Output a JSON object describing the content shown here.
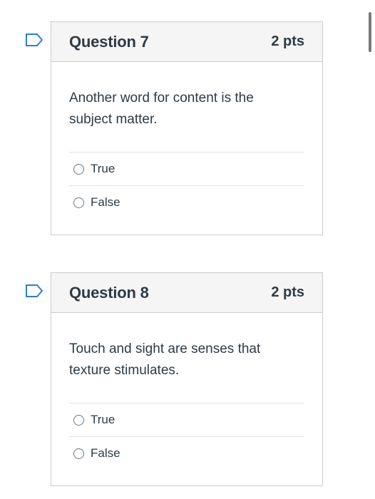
{
  "questions": [
    {
      "title": "Question 7",
      "points": "2 pts",
      "text": "Another word for content is the subject matter.",
      "answers": [
        {
          "label": "True"
        },
        {
          "label": "False"
        }
      ]
    },
    {
      "title": "Question 8",
      "points": "2 pts",
      "text": "Touch and sight are senses that texture stimulates.",
      "answers": [
        {
          "label": "True"
        },
        {
          "label": "False"
        }
      ]
    }
  ],
  "icons": {
    "flag": "flag-outline-icon",
    "radio": "radio-unselected"
  },
  "colors": {
    "text": "#2d3b45",
    "header_bg": "#f5f5f5",
    "border": "#c7cdd1",
    "flag_outline": "#2d7bd6"
  }
}
